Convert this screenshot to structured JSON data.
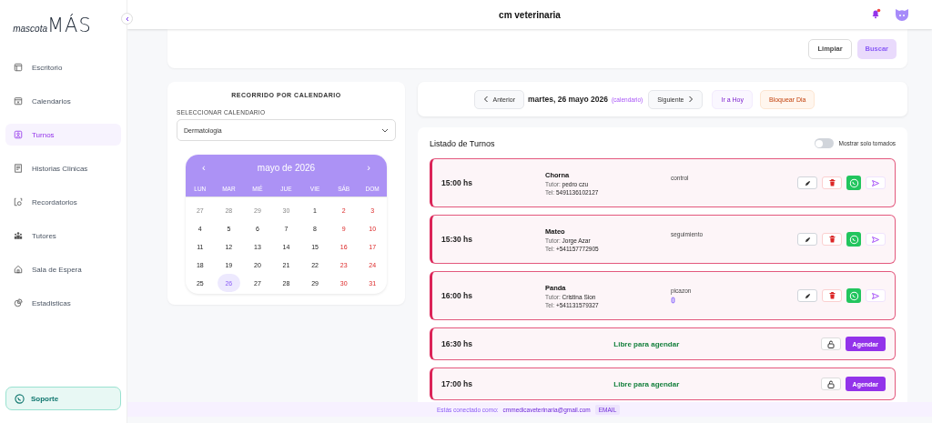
{
  "logo": {
    "prefix": "mascota",
    "suffix": "MÁS"
  },
  "sidebar": {
    "items": [
      {
        "label": "Escritorio",
        "selected": false
      },
      {
        "label": "Calendarios",
        "selected": false
      },
      {
        "label": "Turnos",
        "selected": true
      },
      {
        "label": "Historias Clinicas",
        "selected": false
      },
      {
        "label": "Recordatorios",
        "selected": false
      },
      {
        "label": "Tutores",
        "selected": false
      },
      {
        "label": "Sala de Espera",
        "selected": false
      },
      {
        "label": "Estadisticas",
        "selected": false
      }
    ],
    "support": "Soporte"
  },
  "header": {
    "title": "cm veterinaria",
    "notifications_unread": true
  },
  "filters": {
    "buttons": [
      {
        "label": "Limpiar",
        "disabled": false
      },
      {
        "label": "Buscar",
        "disabled": true
      }
    ]
  },
  "calendar_panel": {
    "title": "RECORRIDO POR CALENDARIO",
    "select_label": "SELECCIONAR CALENDARIO",
    "select_value": "Dermatologia",
    "month": "mayo de 2026",
    "prev": "‹",
    "next": "›",
    "weekdays": [
      "LUN",
      "MAR",
      "MIÉ",
      "JUE",
      "VIE",
      "SÁB",
      "DOM"
    ],
    "days": [
      {
        "label": "27",
        "outside": true,
        "weekend": false,
        "selected": false
      },
      {
        "label": "28",
        "outside": true,
        "weekend": false,
        "selected": false
      },
      {
        "label": "29",
        "outside": true,
        "weekend": false,
        "selected": false
      },
      {
        "label": "30",
        "outside": true,
        "weekend": false,
        "selected": false
      },
      {
        "label": "1",
        "outside": false,
        "weekend": false,
        "selected": false
      },
      {
        "label": "2",
        "outside": false,
        "weekend": true,
        "selected": false
      },
      {
        "label": "3",
        "outside": false,
        "weekend": true,
        "selected": false
      },
      {
        "label": "4",
        "outside": false,
        "weekend": false,
        "selected": false
      },
      {
        "label": "5",
        "outside": false,
        "weekend": false,
        "selected": false
      },
      {
        "label": "6",
        "outside": false,
        "weekend": false,
        "selected": false
      },
      {
        "label": "7",
        "outside": false,
        "weekend": false,
        "selected": false
      },
      {
        "label": "8",
        "outside": false,
        "weekend": false,
        "selected": false
      },
      {
        "label": "9",
        "outside": false,
        "weekend": true,
        "selected": false
      },
      {
        "label": "10",
        "outside": false,
        "weekend": true,
        "selected": false
      },
      {
        "label": "11",
        "outside": false,
        "weekend": false,
        "selected": false
      },
      {
        "label": "12",
        "outside": false,
        "weekend": false,
        "selected": false
      },
      {
        "label": "13",
        "outside": false,
        "weekend": false,
        "selected": false
      },
      {
        "label": "14",
        "outside": false,
        "weekend": false,
        "selected": false
      },
      {
        "label": "15",
        "outside": false,
        "weekend": false,
        "selected": false
      },
      {
        "label": "16",
        "outside": false,
        "weekend": true,
        "selected": false
      },
      {
        "label": "17",
        "outside": false,
        "weekend": true,
        "selected": false
      },
      {
        "label": "18",
        "outside": false,
        "weekend": false,
        "selected": false
      },
      {
        "label": "19",
        "outside": false,
        "weekend": false,
        "selected": false
      },
      {
        "label": "20",
        "outside": false,
        "weekend": false,
        "selected": false
      },
      {
        "label": "21",
        "outside": false,
        "weekend": false,
        "selected": false
      },
      {
        "label": "22",
        "outside": false,
        "weekend": false,
        "selected": false
      },
      {
        "label": "23",
        "outside": false,
        "weekend": true,
        "selected": false
      },
      {
        "label": "24",
        "outside": false,
        "weekend": true,
        "selected": false
      },
      {
        "label": "25",
        "outside": false,
        "weekend": false,
        "selected": false
      },
      {
        "label": "26",
        "outside": false,
        "weekend": false,
        "selected": true
      },
      {
        "label": "27",
        "outside": false,
        "weekend": false,
        "selected": false
      },
      {
        "label": "28",
        "outside": false,
        "weekend": false,
        "selected": false
      },
      {
        "label": "29",
        "outside": false,
        "weekend": false,
        "selected": false
      },
      {
        "label": "30",
        "outside": false,
        "weekend": true,
        "selected": false
      },
      {
        "label": "31",
        "outside": false,
        "weekend": true,
        "selected": false
      }
    ]
  },
  "day_nav": {
    "prev": "Anterior",
    "date": "martes, 26 mayo 2026",
    "source": "(calendario)",
    "next": "Siguiente",
    "today": "Ir a Hoy",
    "block": "Bloquear Dia"
  },
  "list": {
    "title": "Listado de Turnos",
    "toggle_label": "Mostrar solo tomados",
    "toggle_on": false,
    "slots": [
      {
        "kind": "booked",
        "time": "15:00 hs",
        "pet": "Chorna",
        "tutor_label": "Tutor:",
        "tutor": "pedro czu",
        "tel_label": "Tel:",
        "tel": "5491136102127",
        "reason": "control",
        "attachment": false
      },
      {
        "kind": "booked",
        "time": "15:30 hs",
        "pet": "Mateo",
        "tutor_label": "Tutor:",
        "tutor": "Jorge Azar",
        "tel_label": "Tel:",
        "tel": "+541157772905",
        "reason": "seguimiento",
        "attachment": false
      },
      {
        "kind": "booked",
        "time": "16:00 hs",
        "pet": "Panda",
        "tutor_label": "Tutor:",
        "tutor": "Cristina Sion",
        "tel_label": "Tel:",
        "tel": "+541131579327",
        "reason": "picazon",
        "attachment": true
      },
      {
        "kind": "free",
        "time": "16:30 hs",
        "status": "Libre para agendar",
        "action": "Agendar"
      },
      {
        "kind": "free",
        "time": "17:00 hs",
        "status": "Libre para agendar",
        "action": "Agendar"
      }
    ]
  },
  "footer": {
    "prefix": "Estás conectado como:",
    "email": "cmmedicaveterinaria@gmail.com",
    "badge": "EMAIL"
  }
}
